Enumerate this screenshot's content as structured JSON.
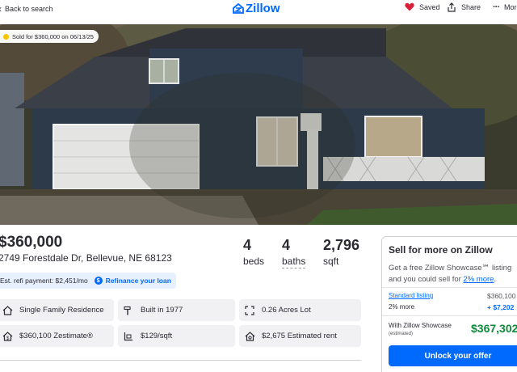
{
  "header": {
    "back_label": "Back to search",
    "logo_text": "Zillow",
    "saved_label": "Saved",
    "share_label": "Share",
    "more_label": "More"
  },
  "photo": {
    "badge": "Sold for $360,000 on 06/13/25"
  },
  "listing": {
    "price": "$360,000",
    "address": "2749 Forestdale Dr, Bellevue, NE 68123",
    "beds": {
      "value": "4",
      "label": "beds"
    },
    "baths": {
      "value": "4",
      "label": "baths"
    },
    "sqft": {
      "value": "2,796",
      "label": "sqft"
    },
    "refi_label": "Est. refi payment: $2,451/mo",
    "refi_link": "Refinance your loan"
  },
  "facts": [
    {
      "icon": "house-icon",
      "text": "Single Family Residence"
    },
    {
      "icon": "hammer-icon",
      "text": "Built in 1977"
    },
    {
      "icon": "lot-icon",
      "text": "0.26 Acres Lot"
    },
    {
      "icon": "zestimate-icon",
      "text": "$360,100 Zestimate®"
    },
    {
      "icon": "price-per-sqft-icon",
      "text": "$129/sqft"
    },
    {
      "icon": "rent-icon",
      "text": "$2,675 Estimated rent"
    }
  ],
  "sell_card": {
    "title": "Sell for more on Zillow",
    "desc_prefix": "Get a free Zillow Showcase℠ listing and you could sell for ",
    "desc_pct": "2% more",
    "desc_suffix": ".",
    "standard_label": "Standard listing",
    "standard_value": "$360,100",
    "more_label": "2% more",
    "more_value": "+ $7,202",
    "showcase_label": "With Zillow Showcase",
    "estimated_label": "(estimated)",
    "showcase_value": "$367,302",
    "cta_label": "Unlock your offer"
  },
  "colors": {
    "brand_blue": "#006aff",
    "saved_heart": "#d8203a",
    "badge_dot": "#f7c600",
    "showcase_green": "#0d8a3a"
  }
}
